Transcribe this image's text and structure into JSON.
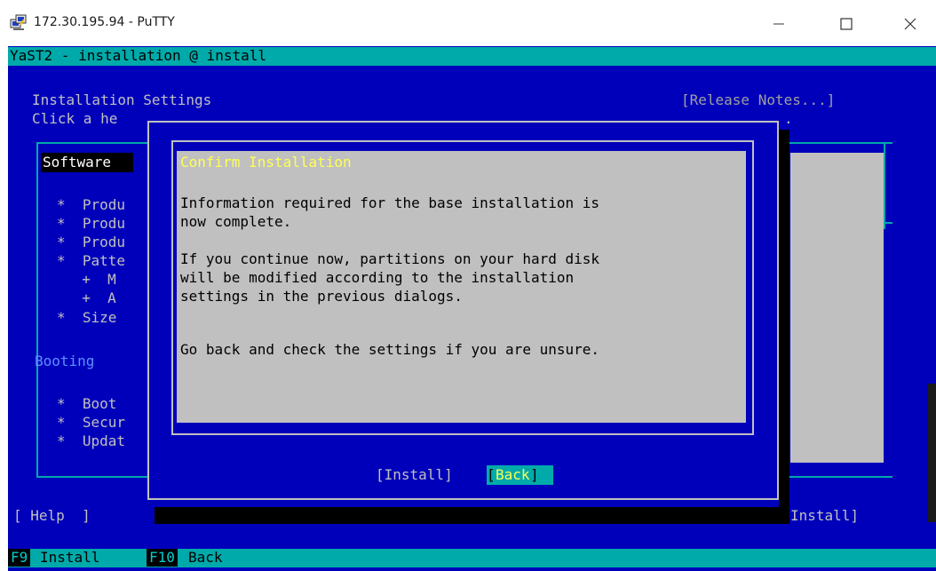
{
  "window": {
    "title": "172.30.195.94 - PuTTY",
    "minimize_glyph": "—",
    "maximize_glyph": "☐",
    "close_glyph": "✕",
    "app_icon": "putty-icon"
  },
  "terminal": {
    "top_status": "YaST2 - installation @ install",
    "screen_title": "Installation Settings",
    "release_notes": "[Release Notes...]",
    "hint": "Click a he",
    "hint_tail": ".",
    "software_header": "Software",
    "software_items": [
      "*  Produ",
      "*  Produ",
      "*  Produ",
      "*  Patte",
      "  +  M",
      "  +  A",
      "*  Size"
    ],
    "booting_header": "Booting",
    "booting_items": [
      "*  Boot",
      "*  Secur",
      "*  Updat"
    ],
    "help_button": "[ Help  ]",
    "install_button_bg": "Install]",
    "function_keys": [
      {
        "key": "F9",
        "label": "Install"
      },
      {
        "key": "F10",
        "label": "Back"
      }
    ]
  },
  "dialog": {
    "title": "Confirm Installation",
    "lines": [
      "Information required for the base installation is",
      "now complete.",
      "",
      "If you continue now, partitions on your hard disk",
      "will be modified according to the installation",
      "settings in the previous dialogs.",
      "",
      "Go back and check the settings if you are unsure."
    ],
    "install_button": "[Install]",
    "back_bracket_open": "[",
    "back_label": "Back",
    "back_bracket_close": "]"
  },
  "colors": {
    "terminal_bg": "#0000bb",
    "cyan": "#00aaaa",
    "gray": "#c0c0c0",
    "yellow": "#ffff55"
  }
}
